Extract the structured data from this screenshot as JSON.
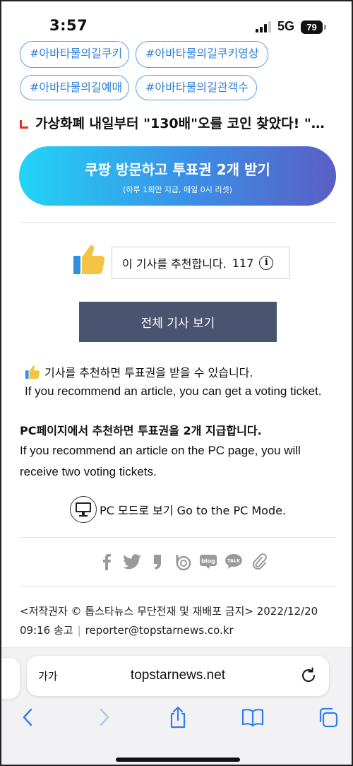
{
  "status_bar": {
    "time": "3:57",
    "network": "5G",
    "battery": "79"
  },
  "tags": [
    "#아바타물의길쿠키",
    "#아바타물의길쿠키영상",
    "#아바타물의길예매",
    "#아바타물의길관객수"
  ],
  "headline": "가상화폐 내일부터 \"130배\"오를 코인 찾았다! \"…",
  "coupang": {
    "title": "쿠팡 방문하고 투표권 2개 받기",
    "subtitle": "(하루 1회만 지급, 매일 0시 리셋)"
  },
  "recommend": {
    "label": "이 기사를 추천합니다.",
    "count": "117",
    "info_glyph": "i"
  },
  "all_articles_button": "전체 기사 보기",
  "notice": {
    "korean": "기사를 추천하면 투표권을 받을 수 있습니다.",
    "english": "If you recommend an article, you can get a voting ticket."
  },
  "pc_notice": {
    "title": "PC페이지에서 추천하면 투표권을 2개 지급합니다.",
    "english": "If you recommend an article on the PC page, you will receive two voting tickets."
  },
  "pc_mode": "PC 모드로 보기 Go to the PC Mode.",
  "share_icons": [
    "facebook-icon",
    "twitter-icon",
    "naver-post-icon",
    "band-icon",
    "blog-icon",
    "talk-icon",
    "link-icon"
  ],
  "share_labels": {
    "blog": "blog",
    "talk": "TALK"
  },
  "copyright": {
    "line1": "<저작권자 © 톱스타뉴스 무단전재 및 재배포 금지> 2022/12/20",
    "time": "09:16 송고",
    "sep": "|",
    "email": "reporter@topstarnews.co.kr"
  },
  "browser": {
    "aa_label": "가가",
    "url": "topstarnews.net"
  },
  "colors": {
    "tag_border": "#5aa0e6",
    "tag_text": "#2f7fd6",
    "button_dark": "#4a5370",
    "headline_mark": "#e8321f"
  }
}
